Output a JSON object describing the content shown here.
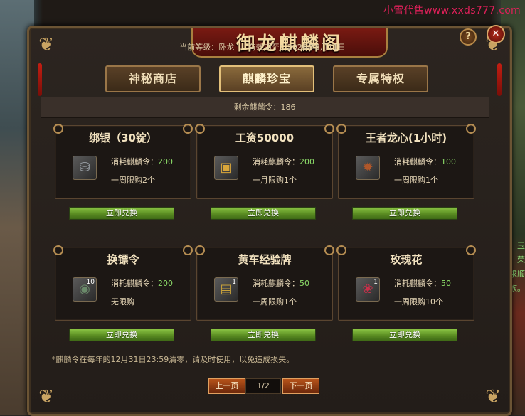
{
  "watermark": "小雪代售www.xxds777.com",
  "side_text": [
    "玉",
    "荣",
    "求顺",
    "族。"
  ],
  "window": {
    "title": "御龙麒麟阁",
    "status": {
      "level": "当前等级：卧龙",
      "expiry": "有效期至：2026年8月11日"
    },
    "tabs": [
      {
        "label": "神秘商店"
      },
      {
        "label": "麒麟珍宝"
      },
      {
        "label": "专属特权"
      }
    ],
    "active_tab": "麒麟珍宝",
    "remaining": "剩余麒麟令：186",
    "cost_label": "消耗麒麟令：",
    "button_label": "立即兑换",
    "items": [
      {
        "name": "绑银（30锭）",
        "cost": "200",
        "limit": "一周限购2个",
        "qty": "",
        "icon": "silver-ingot-icon",
        "glyph": "⛁",
        "color": "#9aa0a6"
      },
      {
        "name": "工资50000",
        "cost": "200",
        "limit": "一月限购1个",
        "qty": "",
        "icon": "gold-box-icon",
        "glyph": "▣",
        "color": "#d9a63a"
      },
      {
        "name": "王者龙心(1小时)",
        "cost": "100",
        "limit": "一周限购1个",
        "qty": "",
        "icon": "dragon-heart-icon",
        "glyph": "✹",
        "color": "#b0572a"
      },
      {
        "name": "换镖令",
        "cost": "200",
        "limit": "无限购",
        "qty": "10",
        "icon": "escort-token-icon",
        "glyph": "◉",
        "color": "#6a8a6a"
      },
      {
        "name": "黄车经验牌",
        "cost": "50",
        "limit": "一周限购1个",
        "qty": "1",
        "icon": "cart-exp-icon",
        "glyph": "▤",
        "color": "#c9a23a"
      },
      {
        "name": "玫瑰花",
        "cost": "50",
        "limit": "一周限购10个",
        "qty": "1",
        "icon": "rose-icon",
        "glyph": "❀",
        "color": "#c8304a"
      }
    ],
    "note": "*麒麟令在每年的12月31日23:59清零，请及时使用，以免造成损失。",
    "pager": {
      "prev": "上一页",
      "page": "1/2",
      "next": "下一页"
    },
    "help": "?",
    "close": "✕"
  }
}
